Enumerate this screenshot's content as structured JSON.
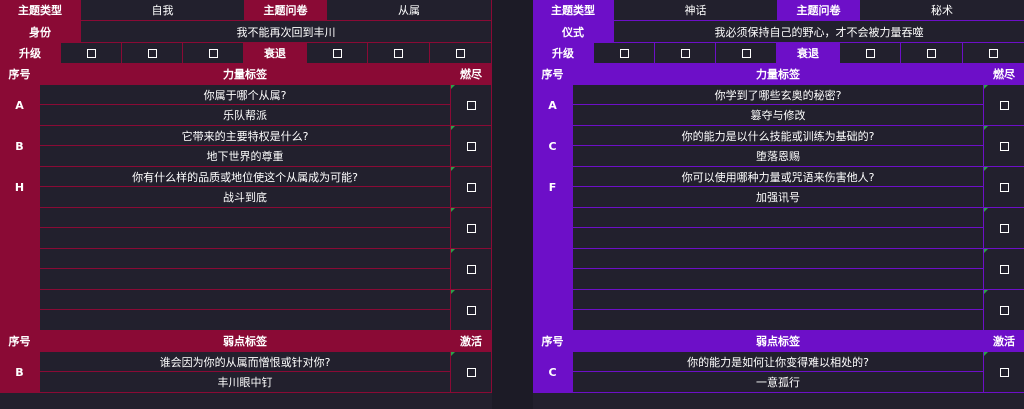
{
  "left": {
    "theme_type_label": "主题类型",
    "theme_type_value": "自我",
    "theme_question_label": "主题问卷",
    "theme_question_value": "从属",
    "identity_label": "身份",
    "identity_value": "我不能再次回到丰川",
    "upgrade_label": "升级",
    "decay_label": "衰退",
    "power_header": {
      "index": "序号",
      "title": "力量标签",
      "action": "燃尽"
    },
    "power_tags": [
      {
        "letter": "A",
        "question": "你属于哪个从属?",
        "answer": "乐队帮派"
      },
      {
        "letter": "B",
        "question": "它带来的主要特权是什么?",
        "answer": "地下世界的尊重"
      },
      {
        "letter": "H",
        "question": "你有什么样的品质或地位使这个从属成为可能?",
        "answer": "战斗到底"
      },
      {
        "letter": "",
        "question": "",
        "answer": ""
      },
      {
        "letter": "",
        "question": "",
        "answer": ""
      },
      {
        "letter": "",
        "question": "",
        "answer": ""
      }
    ],
    "weak_header": {
      "index": "序号",
      "title": "弱点标签",
      "action": "激活"
    },
    "weak_tags": [
      {
        "letter": "B",
        "question": "谁会因为你的从属而憎恨或针对你?",
        "answer": "丰川眼中钉"
      }
    ]
  },
  "right": {
    "theme_type_label": "主题类型",
    "theme_type_value": "神话",
    "theme_question_label": "主题问卷",
    "theme_question_value": "秘术",
    "identity_label": "仪式",
    "identity_value": "我必须保持自己的野心，才不会被力量吞噬",
    "upgrade_label": "升级",
    "decay_label": "衰退",
    "power_header": {
      "index": "序号",
      "title": "力量标签",
      "action": "燃尽"
    },
    "power_tags": [
      {
        "letter": "A",
        "question": "你学到了哪些玄奥的秘密?",
        "answer": "篡夺与修改"
      },
      {
        "letter": "C",
        "question": "你的能力是以什么技能或训练为基础的?",
        "answer": "堕落恩赐"
      },
      {
        "letter": "F",
        "question": "你可以使用哪种力量或咒语来伤害他人?",
        "answer": "加强讯号"
      },
      {
        "letter": "",
        "question": "",
        "answer": ""
      },
      {
        "letter": "",
        "question": "",
        "answer": ""
      },
      {
        "letter": "",
        "question": "",
        "answer": ""
      }
    ],
    "weak_header": {
      "index": "序号",
      "title": "弱点标签",
      "action": "激活"
    },
    "weak_tags": [
      {
        "letter": "C",
        "question": "你的能力是如何让你变得难以相处的?",
        "answer": "一意孤行"
      }
    ]
  },
  "colors": {
    "left_accent": "#8a0a35",
    "right_accent": "#6d0fc8",
    "background": "#22202d",
    "check_marker": "#2ba14a"
  }
}
